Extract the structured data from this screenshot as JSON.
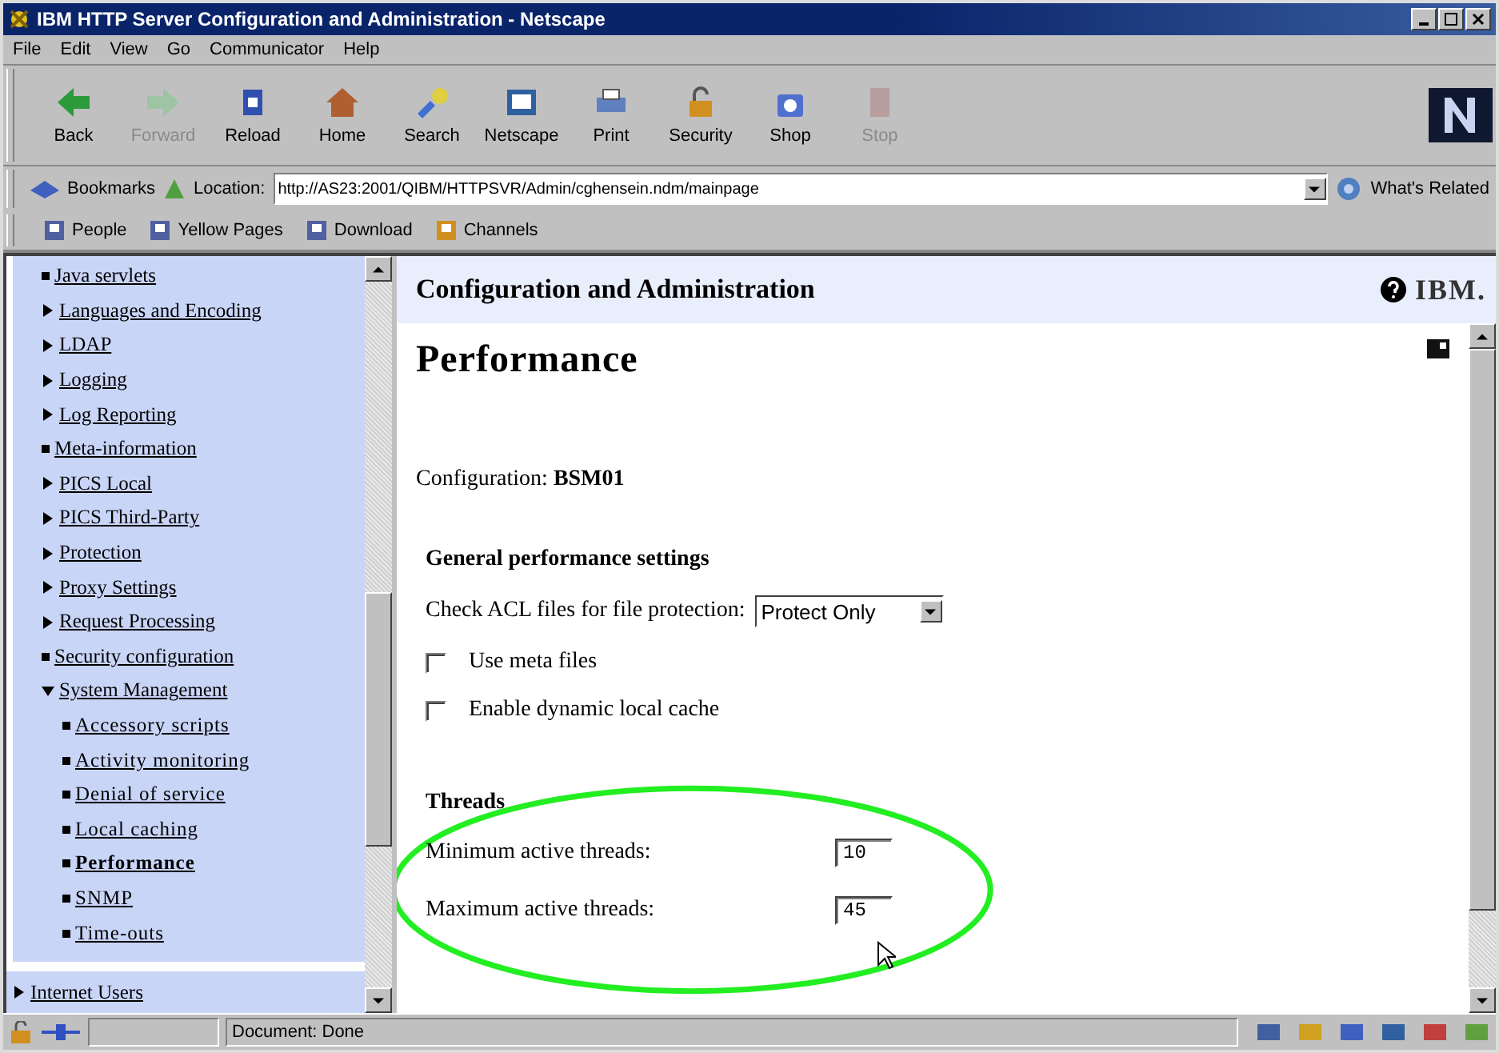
{
  "window": {
    "title": "IBM HTTP Server Configuration and Administration - Netscape"
  },
  "menu": [
    "File",
    "Edit",
    "View",
    "Go",
    "Communicator",
    "Help"
  ],
  "nav_buttons": [
    {
      "label": "Back",
      "kind": "back",
      "disabled": false
    },
    {
      "label": "Forward",
      "kind": "forward",
      "disabled": true
    },
    {
      "label": "Reload",
      "kind": "reload",
      "disabled": false
    },
    {
      "label": "Home",
      "kind": "home",
      "disabled": false
    },
    {
      "label": "Search",
      "kind": "search",
      "disabled": false
    },
    {
      "label": "Netscape",
      "kind": "netscape",
      "disabled": false
    },
    {
      "label": "Print",
      "kind": "print",
      "disabled": false
    },
    {
      "label": "Security",
      "kind": "security",
      "disabled": false
    },
    {
      "label": "Shop",
      "kind": "shop",
      "disabled": false
    },
    {
      "label": "Stop",
      "kind": "stop",
      "disabled": true
    }
  ],
  "location_bar": {
    "bookmarks": "Bookmarks",
    "location_label": "Location:",
    "url": "http://AS23:2001/QIBM/HTTPSVR/Admin/cghensein.ndm/mainpage",
    "whats_related": "What's Related"
  },
  "personal_toolbar": [
    "People",
    "Yellow Pages",
    "Download",
    "Channels"
  ],
  "sidebar": {
    "items": [
      {
        "label": "Java servlets",
        "kind": "page",
        "selected": false
      },
      {
        "label": "Languages and Encoding",
        "kind": "folder",
        "expanded": false,
        "selected": false
      },
      {
        "label": "LDAP",
        "kind": "folder",
        "expanded": false,
        "selected": false
      },
      {
        "label": "Logging",
        "kind": "folder",
        "expanded": false,
        "selected": false
      },
      {
        "label": "Log Reporting",
        "kind": "folder",
        "expanded": false,
        "selected": false
      },
      {
        "label": "Meta-information",
        "kind": "page",
        "selected": false
      },
      {
        "label": "PICS Local",
        "kind": "folder",
        "expanded": false,
        "selected": false
      },
      {
        "label": "PICS Third-Party",
        "kind": "folder",
        "expanded": false,
        "selected": false
      },
      {
        "label": "Protection",
        "kind": "folder",
        "expanded": false,
        "selected": false
      },
      {
        "label": "Proxy Settings",
        "kind": "folder",
        "expanded": false,
        "selected": false
      },
      {
        "label": "Request Processing",
        "kind": "folder",
        "expanded": false,
        "selected": false
      },
      {
        "label": "Security configuration",
        "kind": "page",
        "selected": false
      },
      {
        "label": "System Management",
        "kind": "folder",
        "expanded": true,
        "selected": false,
        "children": [
          {
            "label": "Accessory scripts",
            "kind": "page",
            "selected": false
          },
          {
            "label": "Activity monitoring",
            "kind": "page",
            "selected": false
          },
          {
            "label": "Denial of service",
            "kind": "page",
            "selected": false
          },
          {
            "label": "Local caching",
            "kind": "page",
            "selected": false
          },
          {
            "label": "Performance",
            "kind": "page",
            "selected": true
          },
          {
            "label": "SNMP",
            "kind": "page",
            "selected": false
          },
          {
            "label": "Time-outs",
            "kind": "page",
            "selected": false
          }
        ]
      }
    ],
    "footer_item": {
      "label": "Internet Users",
      "kind": "folder",
      "expanded": false,
      "selected": false
    }
  },
  "header": {
    "title": "Configuration and Administration",
    "logo": "IBM."
  },
  "page": {
    "title": "Performance",
    "configuration_label": "Configuration:",
    "configuration_value": "BSM01",
    "general_heading": "General performance settings",
    "acl_label": "Check ACL files for file protection:",
    "acl_value": "Protect Only",
    "checkboxes": [
      {
        "label": "Use meta files",
        "checked": false
      },
      {
        "label": "Enable dynamic local cache",
        "checked": false
      }
    ],
    "threads_heading": "Threads",
    "thread_fields": [
      {
        "label": "Minimum active threads:",
        "value": "10"
      },
      {
        "label": "Maximum active threads:",
        "value": "45"
      }
    ]
  },
  "status_bar": {
    "text": "Document: Done"
  }
}
